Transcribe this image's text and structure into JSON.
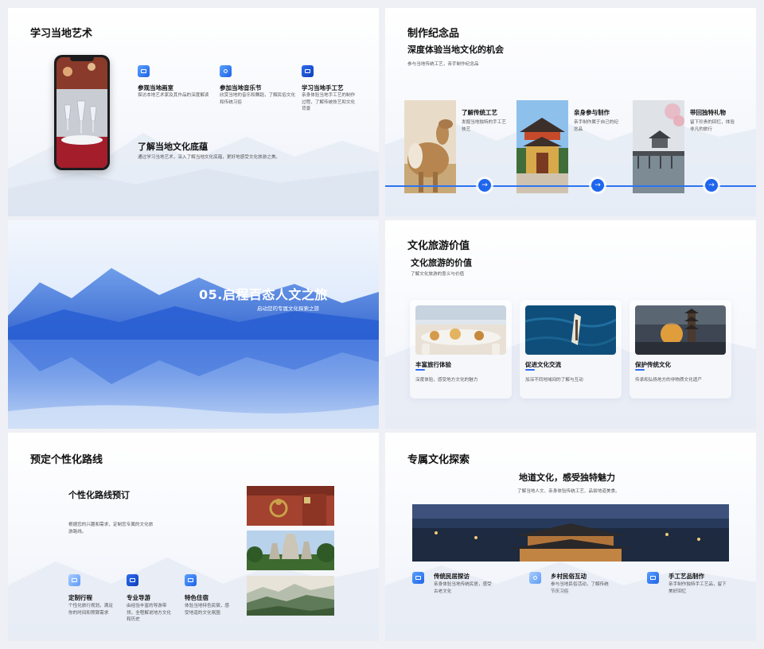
{
  "slide1": {
    "title": "学习当地艺术",
    "features": [
      {
        "title": "参观当地画室",
        "desc": "探访本地艺术家及其作品的深度解读",
        "icon": "gallery-icon"
      },
      {
        "title": "参加当地音乐节",
        "desc": "欣赏当地的音乐和舞蹈，了解民俗文化和传统习俗",
        "icon": "music-icon"
      },
      {
        "title": "学习当地手工艺",
        "desc": "亲身体验当地手工艺的制作过程，了解传统技艺和文化背景",
        "icon": "craft-icon"
      }
    ],
    "heading": "了解当地文化底蕴",
    "desc": "通过学习当地艺术，深入了解当地文化底蕴，更好地感受文化旅游之美。"
  },
  "slide2": {
    "title": "制作纪念品",
    "subtitle": "深度体验当地文化的机会",
    "desc": "参与当地传统工艺，亲手制作纪念品",
    "steps": [
      {
        "title": "了解传统工艺",
        "desc": "发掘当地独特的手工艺技艺"
      },
      {
        "title": "亲身参与制作",
        "desc": "亲手制作属于自己的纪念品"
      },
      {
        "title": "带回独特礼物",
        "desc": "留下珍贵的回忆，体验非凡的旅行"
      }
    ],
    "arrow": "→"
  },
  "slide3": {
    "title": "05.启程百态人文之旅",
    "subtitle": "启动您的专属文化探索之旅"
  },
  "slide4": {
    "title": "文化旅游价值",
    "subtitle": "文化旅游的价值",
    "desc": "了解文化旅游的意义与价值",
    "cards": [
      {
        "title": "丰富旅行体验",
        "desc": "深度体验，感受地方文化的魅力"
      },
      {
        "title": "促进文化交流",
        "desc": "加深不同地域间的了解与互动"
      },
      {
        "title": "保护传统文化",
        "desc": "传承和弘扬地方的非物质文化遗产"
      }
    ]
  },
  "slide5": {
    "title": "预定个性化路线",
    "heading": "个性化路线预订",
    "desc": "根据您的兴趣和需求，定制您专属的文化旅游路线。",
    "features": [
      {
        "title": "定制行程",
        "desc": "个性化旅行规划，满足你的时间和预算需求",
        "icon": "itinerary-icon"
      },
      {
        "title": "专业导游",
        "desc": "由经验丰富的导游带领，全程解说地方文化和历史",
        "icon": "guide-icon"
      },
      {
        "title": "特色住宿",
        "desc": "体验当地特色民宿，感受地道的文化氛围",
        "icon": "lodging-icon"
      }
    ]
  },
  "slide6": {
    "title": "专属文化探索",
    "heading": "地道文化，感受独特魅力",
    "desc": "了解当地人文、亲身体验传统工艺、品尝地道美食。",
    "features": [
      {
        "title": "传统民居探访",
        "desc": "亲身体验当地传统民居，感受古老文化",
        "icon": "house-icon"
      },
      {
        "title": "乡村民俗互动",
        "desc": "参与当地民俗活动，了解传统节庆习俗",
        "icon": "folk-icon"
      },
      {
        "title": "手工艺品制作",
        "desc": "亲手制作独特手工艺品，留下美好回忆",
        "icon": "handicraft-icon"
      }
    ]
  }
}
